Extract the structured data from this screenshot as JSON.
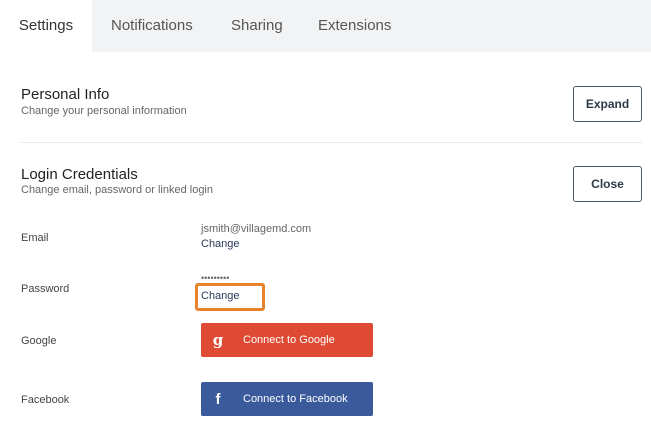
{
  "tabs": [
    {
      "label": "Settings"
    },
    {
      "label": "Notifications"
    },
    {
      "label": "Sharing"
    },
    {
      "label": "Extensions"
    }
  ],
  "personal_info": {
    "title": "Personal Info",
    "subtitle": "Change your personal information",
    "button_label": "Expand"
  },
  "login_credentials": {
    "title": "Login Credentials",
    "subtitle": "Change email, password or linked login",
    "button_label": "Close"
  },
  "email": {
    "label": "Email",
    "value": "jsmith@villagemd.com",
    "change_label": "Change"
  },
  "password": {
    "label": "Password",
    "value": "•••••••••",
    "change_label": "Change"
  },
  "google": {
    "label": "Google",
    "button_label": "Connect to Google",
    "icon_glyph": "g",
    "color": "#df4a35"
  },
  "facebook": {
    "label": "Facebook",
    "button_label": "Connect to Facebook",
    "icon_glyph": "f",
    "color": "#3a5a9c"
  },
  "highlight_color": "#e8822d"
}
